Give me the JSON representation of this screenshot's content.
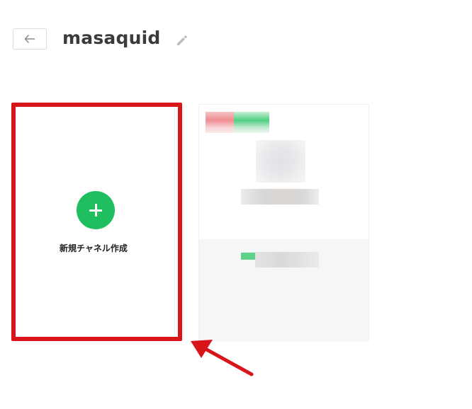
{
  "header": {
    "title": "masaquid"
  },
  "create_card": {
    "label": "新規チャネル作成"
  },
  "icons": {
    "back": "arrow-left-icon",
    "edit": "pencil-icon",
    "create": "plus-icon"
  },
  "colors": {
    "accent_green": "#1fbf5f",
    "highlight_red": "#d7151b"
  }
}
